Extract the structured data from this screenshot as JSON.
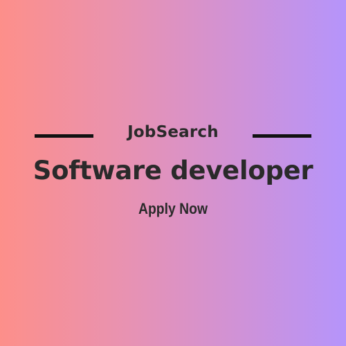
{
  "brand": "JobSearch",
  "title": "Software developer",
  "cta": "Apply Now",
  "colors": {
    "gradient_start": "#fd8f8a",
    "gradient_end": "#b594fb",
    "text": "#2a2a2a",
    "rule": "#111111"
  }
}
